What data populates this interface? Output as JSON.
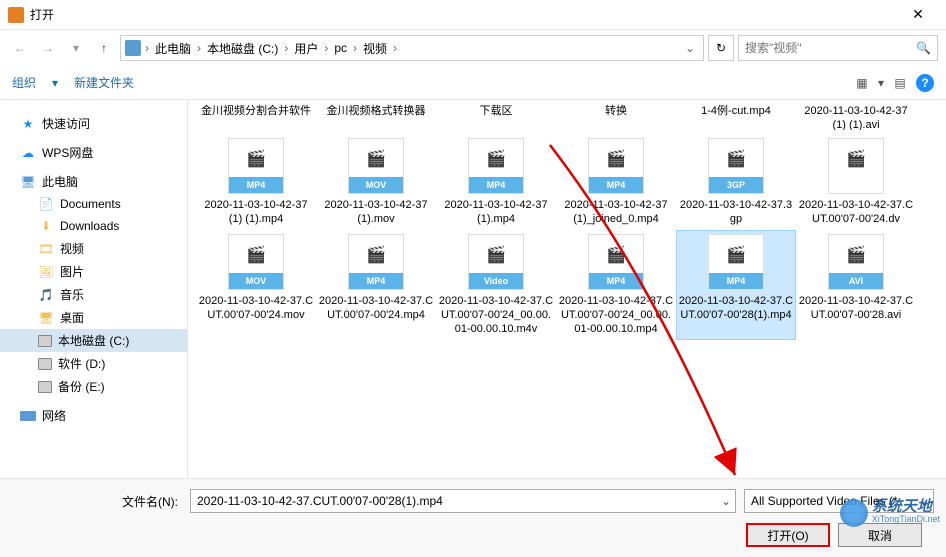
{
  "window": {
    "title": "打开"
  },
  "breadcrumb": {
    "items": [
      "此电脑",
      "本地磁盘 (C:)",
      "用户",
      "pc",
      "视频"
    ]
  },
  "search": {
    "placeholder": "搜索\"视频\""
  },
  "toolbar": {
    "organize": "组织",
    "newfolder": "新建文件夹"
  },
  "sidebar": {
    "quickaccess": "快速访问",
    "wps": "WPS网盘",
    "thispc": "此电脑",
    "documents": "Documents",
    "downloads": "Downloads",
    "videos": "视频",
    "pictures": "图片",
    "music": "音乐",
    "desktop": "桌面",
    "drivec": "本地磁盘 (C:)",
    "drived": "软件 (D:)",
    "drivee": "备份 (E:)",
    "network": "网络"
  },
  "files": [
    {
      "name": "金川视频分割合并软件",
      "badge": "",
      "clipped": true
    },
    {
      "name": "金川视频格式转换器",
      "badge": "",
      "clipped": true
    },
    {
      "name": "下载区",
      "badge": "",
      "clipped": true
    },
    {
      "name": "转换",
      "badge": "",
      "clipped": true
    },
    {
      "name": "1-4例-cut.mp4",
      "badge": "",
      "clipped": true
    },
    {
      "name": "2020-11-03-10-42-37(1) (1).avi",
      "badge": "",
      "clipped": true
    },
    {
      "name": "2020-11-03-10-42-37(1) (1).mp4",
      "badge": "MP4"
    },
    {
      "name": "2020-11-03-10-42-37(1).mov",
      "badge": "MOV"
    },
    {
      "name": "2020-11-03-10-42-37(1).mp4",
      "badge": "MP4"
    },
    {
      "name": "2020-11-03-10-42-37(1)_joined_0.mp4",
      "badge": "MP4"
    },
    {
      "name": "2020-11-03-10-42-37.3gp",
      "badge": "3GP"
    },
    {
      "name": "2020-11-03-10-42-37.CUT.00'07-00'24.dv",
      "badge": ""
    },
    {
      "name": "2020-11-03-10-42-37.CUT.00'07-00'24.mov",
      "badge": "MOV"
    },
    {
      "name": "2020-11-03-10-42-37.CUT.00'07-00'24.mp4",
      "badge": "MP4"
    },
    {
      "name": "2020-11-03-10-42-37.CUT.00'07-00'24_00.00.01-00.00.10.m4v",
      "badge": "Video"
    },
    {
      "name": "2020-11-03-10-42-37.CUT.00'07-00'24_00.00.01-00.00.10.mp4",
      "badge": "MP4"
    },
    {
      "name": "2020-11-03-10-42-37.CUT.00'07-00'28(1).mp4",
      "badge": "MP4",
      "selected": true
    },
    {
      "name": "2020-11-03-10-42-37.CUT.00'07-00'28.avi",
      "badge": "AVI"
    }
  ],
  "footer": {
    "fname_label": "文件名(N):",
    "fname_value": "2020-11-03-10-42-37.CUT.00'07-00'28(1).mp4",
    "filetype": "All Supported Video Files (*",
    "open": "打开(O)",
    "cancel": "取消"
  },
  "watermark": {
    "main": "系统天地",
    "sub": "XiTongTianDi.net"
  }
}
